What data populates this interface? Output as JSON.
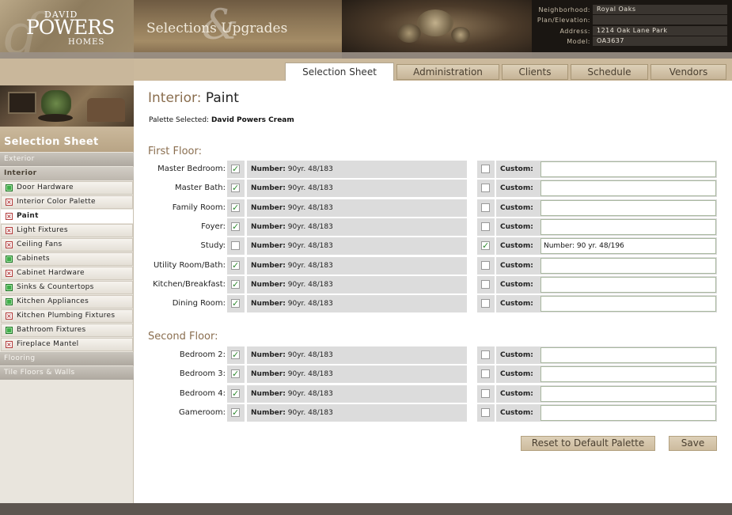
{
  "brand": {
    "line1": "DAVID",
    "line2": "POWERS",
    "line3": "HOMES"
  },
  "banner": {
    "title": "Selections  Upgrades",
    "amp": "&"
  },
  "info": [
    {
      "label": "Neighborhood:",
      "value": "Royal Oaks"
    },
    {
      "label": "Plan/Elevation:",
      "value": ""
    },
    {
      "label": "Address:",
      "value": "1214 Oak Lane Park"
    },
    {
      "label": "Model:",
      "value": "OA3637"
    }
  ],
  "tabs": [
    "Selection Sheet",
    "Administration",
    "Clients",
    "Schedule",
    "Vendors"
  ],
  "sidebar": {
    "heading": "Selection Sheet",
    "categories": {
      "exterior": "Exterior",
      "interior": "Interior",
      "flooring": "Flooring",
      "tile": "Tile Floors & Walls"
    },
    "items": [
      {
        "label": "Door Hardware",
        "status": "ok"
      },
      {
        "label": "Interior Color Palette",
        "status": "x"
      },
      {
        "label": "Paint",
        "status": "x"
      },
      {
        "label": "Light Fixtures",
        "status": "x"
      },
      {
        "label": "Ceiling Fans",
        "status": "x"
      },
      {
        "label": "Cabinets",
        "status": "ok"
      },
      {
        "label": "Cabinet Hardware",
        "status": "x"
      },
      {
        "label": "Sinks & Countertops",
        "status": "ok"
      },
      {
        "label": "Kitchen Appliances",
        "status": "ok"
      },
      {
        "label": "Kitchen Plumbing Fixtures",
        "status": "x"
      },
      {
        "label": "Bathroom Fixtures",
        "status": "ok"
      },
      {
        "label": "Fireplace Mantel",
        "status": "x"
      }
    ]
  },
  "main": {
    "title_prefix": "Interior: ",
    "title_page": "Paint",
    "palette_label": "Palette Selected: ",
    "palette_value": "David Powers Cream",
    "first_floor_title": "First Floor:",
    "second_floor_title": "Second Floor:",
    "number_label": "Number:",
    "custom_label": "Custom:",
    "check_glyph": "✓",
    "first_floor": [
      {
        "room": "Master Bedroom:",
        "std_checked": true,
        "number": "90yr. 48/183",
        "custom_checked": false,
        "custom": ""
      },
      {
        "room": "Master Bath:",
        "std_checked": true,
        "number": "90yr. 48/183",
        "custom_checked": false,
        "custom": ""
      },
      {
        "room": "Family Room:",
        "std_checked": true,
        "number": "90yr. 48/183",
        "custom_checked": false,
        "custom": ""
      },
      {
        "room": "Foyer:",
        "std_checked": true,
        "number": "90yr. 48/183",
        "custom_checked": false,
        "custom": ""
      },
      {
        "room": "Study:",
        "std_checked": false,
        "number": "90yr. 48/183",
        "custom_checked": true,
        "custom": "Number: 90 yr. 48/196"
      },
      {
        "room": "Utility Room/Bath:",
        "std_checked": true,
        "number": "90yr. 48/183",
        "custom_checked": false,
        "custom": ""
      },
      {
        "room": "Kitchen/Breakfast:",
        "std_checked": true,
        "number": "90yr. 48/183",
        "custom_checked": false,
        "custom": ""
      },
      {
        "room": "Dining Room:",
        "std_checked": true,
        "number": "90yr. 48/183",
        "custom_checked": false,
        "custom": ""
      }
    ],
    "second_floor": [
      {
        "room": "Bedroom 2:",
        "std_checked": true,
        "number": "90yr. 48/183",
        "custom_checked": false,
        "custom": ""
      },
      {
        "room": "Bedroom 3:",
        "std_checked": true,
        "number": "90yr. 48/183",
        "custom_checked": false,
        "custom": ""
      },
      {
        "room": "Bedroom 4:",
        "std_checked": true,
        "number": "90yr. 48/183",
        "custom_checked": false,
        "custom": ""
      },
      {
        "room": "Gameroom:",
        "std_checked": true,
        "number": "90yr. 48/183",
        "custom_checked": false,
        "custom": ""
      }
    ],
    "reset_label": "Reset to Default Palette",
    "save_label": "Save"
  }
}
